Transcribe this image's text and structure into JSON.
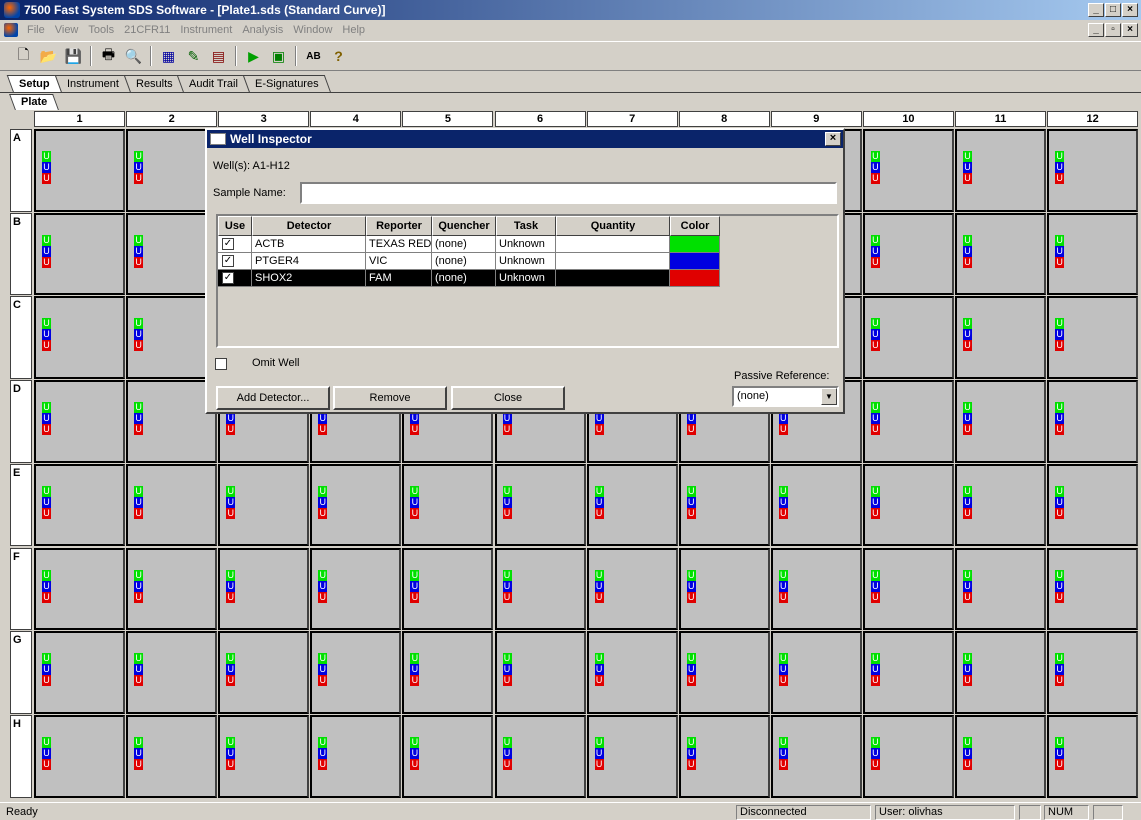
{
  "window": {
    "title": "7500 Fast System SDS Software - [Plate1.sds (Standard Curve)]"
  },
  "menu": [
    "File",
    "View",
    "Tools",
    "21CFR11",
    "Instrument",
    "Analysis",
    "Window",
    "Help"
  ],
  "tabs": [
    "Setup",
    "Instrument",
    "Results",
    "Audit Trail",
    "E-Signatures"
  ],
  "subtab": "Plate",
  "columns": [
    "1",
    "2",
    "3",
    "4",
    "5",
    "6",
    "7",
    "8",
    "9",
    "10",
    "11",
    "12"
  ],
  "rows": [
    "A",
    "B",
    "C",
    "D",
    "E",
    "F",
    "G",
    "H"
  ],
  "well_marker": "U",
  "dialog": {
    "title": "Well Inspector",
    "wells": "Well(s): A1-H12",
    "sample_label": "Sample Name:",
    "sample_value": "",
    "headers": [
      "Use",
      "Detector",
      "Reporter",
      "Quencher",
      "Task",
      "Quantity",
      "Color"
    ],
    "detectors": [
      {
        "use": "✓",
        "detector": "ACTB",
        "reporter": "TEXAS RED",
        "quencher": "(none)",
        "task": "Unknown",
        "quantity": "",
        "color": "#00e000",
        "selected": false
      },
      {
        "use": "✓",
        "detector": "PTGER4",
        "reporter": "VIC",
        "quencher": "(none)",
        "task": "Unknown",
        "quantity": "",
        "color": "#0000e0",
        "selected": false
      },
      {
        "use": "✓",
        "detector": "SHOX2",
        "reporter": "FAM",
        "quencher": "(none)",
        "task": "Unknown",
        "quantity": "",
        "color": "#e00000",
        "selected": true
      }
    ],
    "omit_label": "Omit Well",
    "add_button": "Add Detector...",
    "remove_button": "Remove",
    "close_button": "Close",
    "passive_label": "Passive Reference:",
    "passive_value": "(none)"
  },
  "status": {
    "left": "Ready",
    "connection": "Disconnected",
    "user": "User: olivhas",
    "num": "NUM"
  }
}
